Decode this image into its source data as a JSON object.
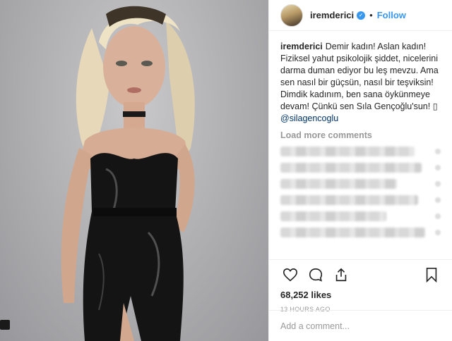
{
  "post": {
    "photo_alt": "",
    "username": "iremderici",
    "verified": true,
    "follow_label": "Follow",
    "separator": "•"
  },
  "caption": {
    "username": "iremderici",
    "text": "Demir kadın! Aslan kadın! Fiziksel yahut psikolojik şiddet, nicelerini darma duman ediyor bu leş mevzu. Ama sen nasıl bir güçsün, nasıl bir teşviksin! Dimdik kadınım, ben sana öykünmeye devam! Çünkü sen Sıla Gençoğlu'sun! ▯",
    "mention": "@silagencoglu"
  },
  "comments": {
    "load_more_label": "Load more comments",
    "blurred_rows": 6
  },
  "actions": {
    "like_icon": "heart-icon",
    "comment_icon": "comment-icon",
    "share_icon": "share-icon",
    "save_icon": "bookmark-icon",
    "likes_text": "68,252 likes",
    "timestamp": "13 HOURS AGO"
  },
  "add_comment": {
    "placeholder": "Add a comment..."
  },
  "colors": {
    "link_blue": "#3897f0",
    "mention_blue": "#003569",
    "muted": "#999999",
    "border": "#efefef"
  }
}
